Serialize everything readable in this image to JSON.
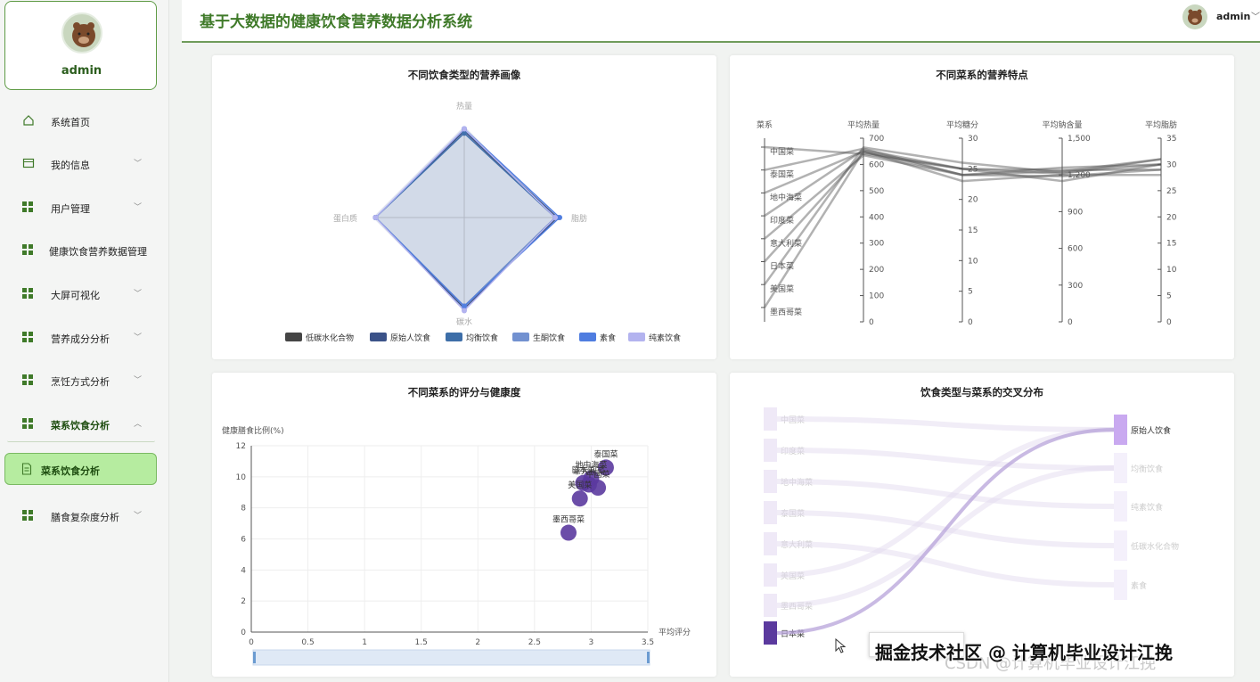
{
  "app": {
    "title": "基于大数据的健康饮食营养数据分析系统",
    "username": "admin",
    "user_chevron": "﹀"
  },
  "sidebar": {
    "profile_name": "admin",
    "items": [
      {
        "label": "系统首页",
        "icon": "home-icon"
      },
      {
        "label": "我的信息",
        "icon": "card-icon",
        "chev": "﹀"
      },
      {
        "label": "用户管理",
        "icon": "grid-icon",
        "chev": "﹀"
      },
      {
        "label": "健康饮食营养数据管理",
        "icon": "grid-icon"
      },
      {
        "label": "大屏可视化",
        "icon": "grid-icon",
        "chev": "﹀"
      },
      {
        "label": "营养成分分析",
        "icon": "grid-icon",
        "chev": "﹀"
      },
      {
        "label": "烹饪方式分析",
        "icon": "grid-icon",
        "chev": "﹀"
      },
      {
        "label": "菜系饮食分析",
        "icon": "grid-icon",
        "chev": "︿"
      },
      {
        "label": "膳食复杂度分析",
        "icon": "grid-icon",
        "chev": "﹀"
      }
    ],
    "active_sub": "菜系饮食分析"
  },
  "panels": {
    "radar_title": "不同饮食类型的营养画像",
    "parallel_title": "不同菜系的营养特点",
    "scatter_title": "不同菜系的评分与健康度",
    "sankey_title": "饮食类型与菜系的交叉分布"
  },
  "colors": {
    "accent": "#3f7a29",
    "active_bg": "#b6eca0",
    "purple": "#5b3a9e"
  },
  "chart_data": [
    {
      "type": "radar",
      "indicators": [
        "热量",
        "脂肪",
        "碳水",
        "蛋白质"
      ],
      "legend_position": "bottom",
      "series": [
        {
          "name": "低碳水化合物",
          "color": "#454545",
          "values": [
            0.78,
            0.82,
            0.8,
            0.8
          ]
        },
        {
          "name": "原始人饮食",
          "color": "#3b5288",
          "values": [
            0.78,
            0.84,
            0.82,
            0.8
          ]
        },
        {
          "name": "均衡饮食",
          "color": "#3d6ea8",
          "values": [
            0.76,
            0.82,
            0.8,
            0.8
          ]
        },
        {
          "name": "生酮饮食",
          "color": "#7291d0",
          "values": [
            0.8,
            0.82,
            0.8,
            0.8
          ]
        },
        {
          "name": "素食",
          "color": "#4f7de0",
          "values": [
            0.8,
            0.86,
            0.8,
            0.8
          ]
        },
        {
          "name": "纯素饮食",
          "color": "#b3b3ef",
          "values": [
            0.8,
            0.82,
            0.84,
            0.8
          ]
        }
      ]
    },
    {
      "type": "parallel",
      "axes": [
        {
          "name": "菜系",
          "categories": [
            "中国菜",
            "泰国菜",
            "地中海菜",
            "印度菜",
            "意大利菜",
            "日本菜",
            "美国菜",
            "墨西哥菜"
          ]
        },
        {
          "name": "平均热量",
          "ticks": [
            "0",
            "100",
            "200",
            "300",
            "400",
            "500",
            "600",
            "700"
          ],
          "max": 700
        },
        {
          "name": "平均糖分",
          "ticks": [
            "0",
            "5",
            "10",
            "15",
            "20",
            "25",
            "30"
          ],
          "max": 30
        },
        {
          "name": "平均钠含量",
          "ticks": [
            "0",
            "300",
            "600",
            "900",
            "1,200",
            "1,500"
          ],
          "max": 1500
        },
        {
          "name": "平均脂肪",
          "ticks": [
            "0",
            "5",
            "10",
            "15",
            "20",
            "25",
            "30",
            "35"
          ],
          "max": 35
        }
      ],
      "lines": [
        {
          "cuisine": "中国菜",
          "calories": 640,
          "sugar": 25,
          "sodium": 1150,
          "fat": 30
        },
        {
          "cuisine": "泰国菜",
          "calories": 660,
          "sugar": 24,
          "sodium": 1230,
          "fat": 31
        },
        {
          "cuisine": "地中海菜",
          "calories": 650,
          "sugar": 23,
          "sodium": 1200,
          "fat": 28
        },
        {
          "cuisine": "印度菜",
          "calories": 655,
          "sugar": 25,
          "sodium": 1240,
          "fat": 29
        },
        {
          "cuisine": "意大利菜",
          "calories": 635,
          "sugar": 24,
          "sodium": 1260,
          "fat": 30
        },
        {
          "cuisine": "日本菜",
          "calories": 645,
          "sugar": 25,
          "sodium": 1210,
          "fat": 31
        },
        {
          "cuisine": "美国菜",
          "calories": 665,
          "sugar": 26,
          "sodium": 1220,
          "fat": 30
        },
        {
          "cuisine": "墨西哥菜",
          "calories": 650,
          "sugar": 24,
          "sodium": 1190,
          "fat": 29
        }
      ]
    },
    {
      "type": "scatter",
      "ylabel": "健康膳食比例(%)",
      "xlabel": "平均评分",
      "xlim": [
        0,
        3.5
      ],
      "ylim": [
        0,
        12
      ],
      "xticks": [
        "0",
        "0.5",
        "1",
        "1.5",
        "2",
        "2.5",
        "3",
        "3.5"
      ],
      "yticks": [
        "0",
        "2",
        "4",
        "6",
        "8",
        "10",
        "12"
      ],
      "points": [
        {
          "name": "泰国菜",
          "x": 3.13,
          "y": 10.6
        },
        {
          "name": "地中海菜",
          "x": 3.0,
          "y": 9.9
        },
        {
          "name": "日本菜",
          "x": 2.93,
          "y": 9.6
        },
        {
          "name": "中国菜",
          "x": 3.06,
          "y": 9.3
        },
        {
          "name": "意大利菜",
          "x": 2.98,
          "y": 9.5
        },
        {
          "name": "美国菜",
          "x": 2.9,
          "y": 8.6
        },
        {
          "name": "墨西哥菜",
          "x": 2.8,
          "y": 6.4
        }
      ]
    },
    {
      "type": "sankey",
      "left_nodes": [
        "中国菜",
        "印度菜",
        "地中海菜",
        "泰国菜",
        "意大利菜",
        "美国菜",
        "墨西哥菜",
        "日本菜"
      ],
      "right_nodes": [
        "原始人饮食",
        "均衡饮食",
        "纯素饮食",
        "低碳水化合物",
        "素食"
      ],
      "highlight_link": {
        "from": "日本菜",
        "to": "原始人饮食"
      }
    }
  ],
  "watermark": "掘金技术社区 @ 计算机毕业设计江挽",
  "watermark_sub": "CSDN @计算机毕业设计江挽"
}
